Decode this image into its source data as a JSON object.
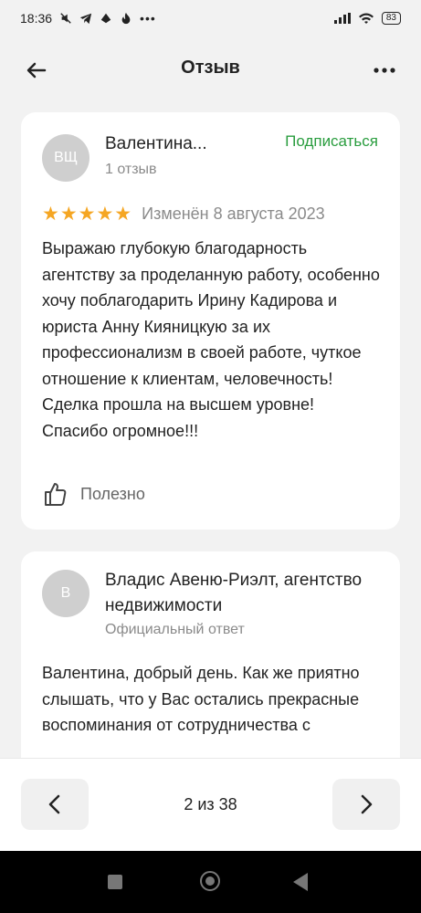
{
  "status": {
    "time": "18:36",
    "battery": "83"
  },
  "header": {
    "title": "Отзыв"
  },
  "review": {
    "avatar_initials": "ВЩ",
    "author": "Валентина...",
    "subscribe_label": "Подписаться",
    "reviews_count": "1 отзыв",
    "stars": "★★★★★",
    "rating": 5,
    "edited": "Изменён 8 августа 2023",
    "text": "Выражаю глубокую благодарность агентству за проделанную работу, особенно хочу поблагодарить Ирину Кадирова и юриста Анну Кияницкую за их профессионализм в своей работе, чуткое отношение к клиентам, человечность! Сделка прошла на высшем уровне! Спасибо огромное!!!",
    "helpful_label": "Полезно"
  },
  "reply": {
    "avatar_initials": "В",
    "org": "Владис Авеню-Риэлт, агентство недвижимости",
    "label": "Официальный ответ",
    "text": "Валентина, добрый день. Как же приятно слышать, что у Вас остались прекрасные воспоминания от сотрудничества с"
  },
  "pager": {
    "info": "2 из 38"
  },
  "colors": {
    "accent": "#2a9d3f",
    "star": "#f5a623"
  }
}
